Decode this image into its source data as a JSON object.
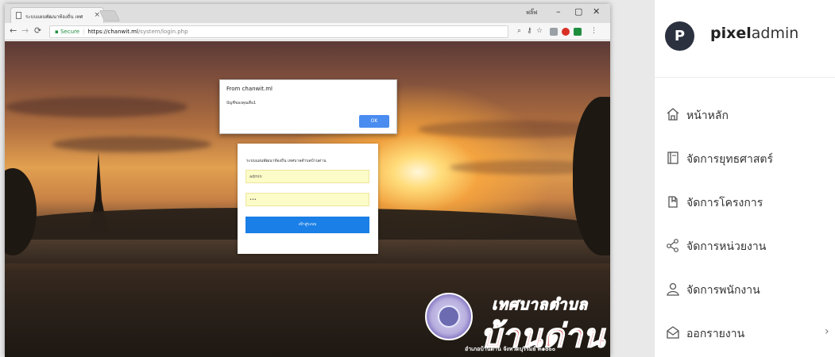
{
  "browser": {
    "tab_title": "ระบบแผนพัฒนาท้องถิ่น เทศ",
    "window_user": "ฟลิ๊ฟ",
    "window_controls": [
      "–",
      "▢",
      "✕"
    ],
    "url": {
      "secure_label": "Secure",
      "host": "https://chanwit.ml",
      "path": "/system/login.php"
    }
  },
  "alert": {
    "title": "From chanwit.ml",
    "message": "บัญชีของคุณคือ1",
    "ok_label": "OK"
  },
  "login": {
    "heading": "ระบบแผนพัฒนาท้องถิ่น เทศบาลตำบลบ้านด่าน",
    "username_value": "admin",
    "password_value": "•••",
    "submit_label": "เข้าสู่ระบบ"
  },
  "logo": {
    "line1": "เทศบาลตำบล",
    "line2": "บ้านด่าน",
    "line3": "อำเภอบ้านด่าน จังหวัดบุรีรัมย์ ๓๑๐๐๐"
  },
  "sidebar": {
    "brand_mark": "P",
    "brand_bold": "pixel",
    "brand_light": "admin",
    "items": [
      {
        "label": "หน้าหลัก",
        "icon": "home-icon"
      },
      {
        "label": "จัดการยุทธศาสตร์",
        "icon": "book-icon"
      },
      {
        "label": "จัดการโครงการ",
        "icon": "folder-icon"
      },
      {
        "label": "จัดการหน่วยงาน",
        "icon": "share-icon"
      },
      {
        "label": "จัดการพนักงาน",
        "icon": "user-icon"
      },
      {
        "label": "ออกรายงาน",
        "icon": "report-icon",
        "arrow": "›"
      }
    ]
  }
}
